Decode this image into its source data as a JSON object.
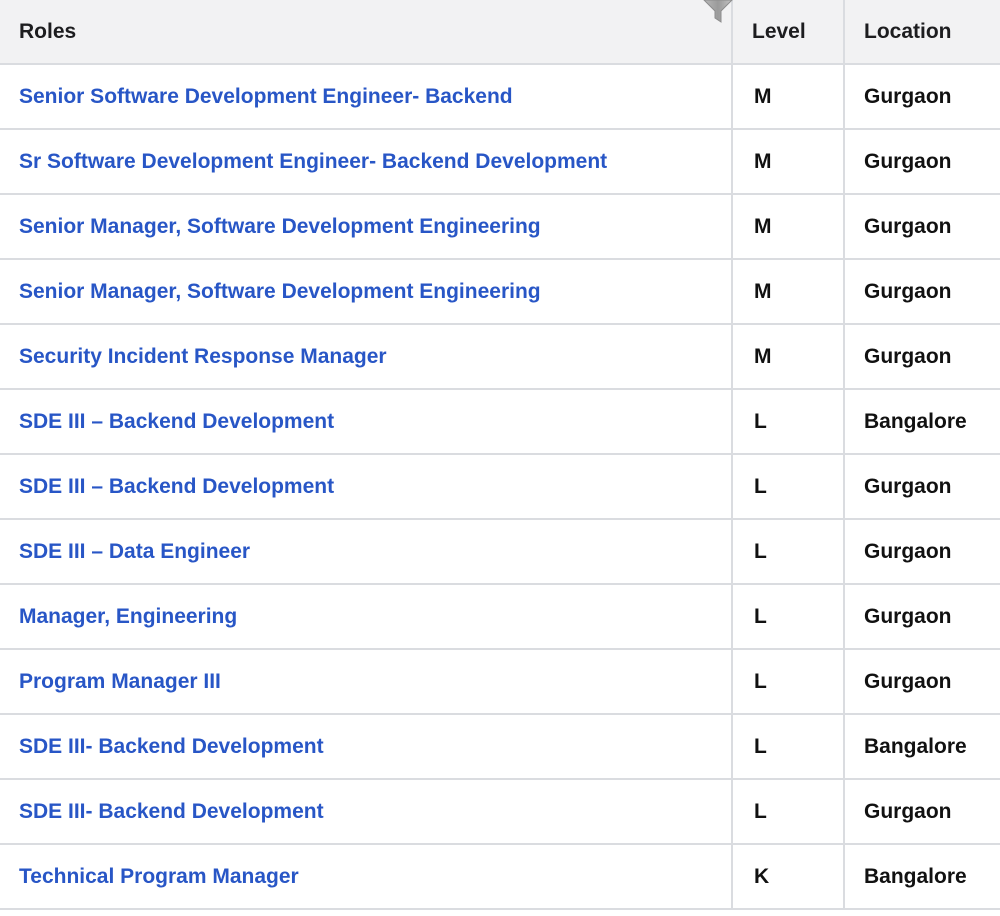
{
  "table": {
    "headers": {
      "roles": "Roles",
      "level": "Level",
      "location": "Location"
    },
    "rows": [
      {
        "role": "Senior Software Development Engineer- Backend",
        "level": "M",
        "location": "Gurgaon"
      },
      {
        "role": "Sr Software Development Engineer- Backend Development",
        "level": "M",
        "location": "Gurgaon"
      },
      {
        "role": "Senior Manager, Software Development Engineering",
        "level": "M",
        "location": "Gurgaon"
      },
      {
        "role": "Senior Manager, Software Development Engineering",
        "level": "M",
        "location": "Gurgaon"
      },
      {
        "role": "Security Incident Response Manager",
        "level": "M",
        "location": "Gurgaon"
      },
      {
        "role": "SDE III – Backend Development",
        "level": "L",
        "location": "Bangalore"
      },
      {
        "role": "SDE III – Backend Development",
        "level": "L",
        "location": "Gurgaon"
      },
      {
        "role": "SDE III – Data Engineer",
        "level": "L",
        "location": "Gurgaon"
      },
      {
        "role": "Manager, Engineering",
        "level": "L",
        "location": "Gurgaon"
      },
      {
        "role": "Program Manager III",
        "level": "L",
        "location": "Gurgaon"
      },
      {
        "role": "SDE III- Backend Development",
        "level": "L",
        "location": "Bangalore"
      },
      {
        "role": "SDE III- Backend Development",
        "level": "L",
        "location": "Gurgaon"
      },
      {
        "role": "Technical Program Manager",
        "level": "K",
        "location": "Bangalore"
      }
    ]
  },
  "icons": {
    "filter": "filter-icon"
  },
  "colors": {
    "link": "#2856c6",
    "header_bg": "#f2f2f3",
    "border": "#dadce0",
    "text": "#111111"
  }
}
